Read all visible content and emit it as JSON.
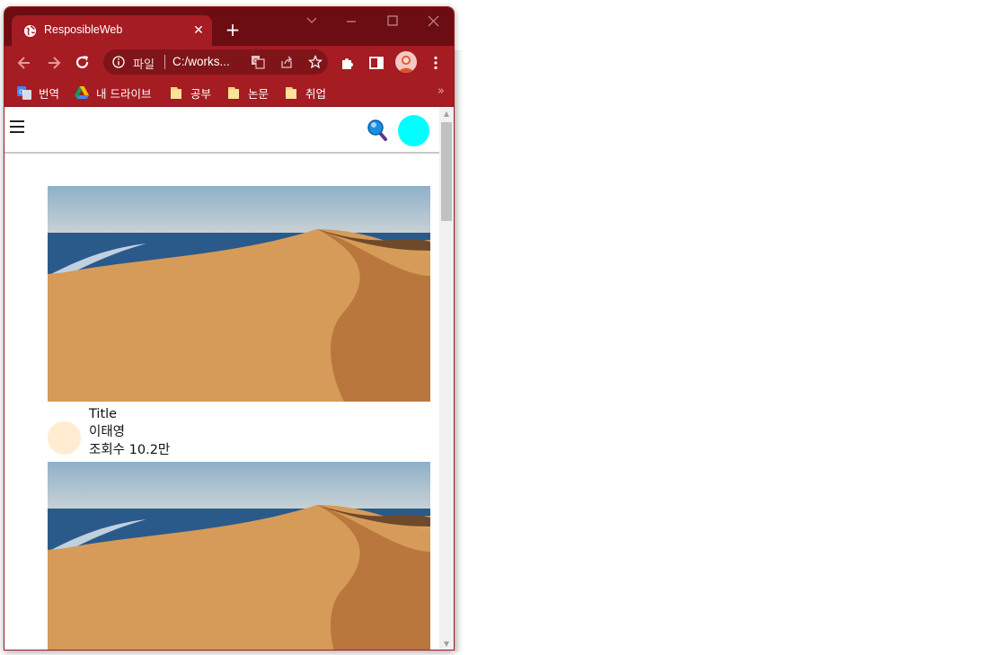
{
  "browser": {
    "tab_title": "ResposibleWeb",
    "omnibox": {
      "scheme_label": "파일",
      "url": "C:/works..."
    },
    "bookmarks": [
      {
        "label": "번역",
        "icon": "translate-icon"
      },
      {
        "label": "내 드라이브",
        "icon": "google-drive-icon"
      },
      {
        "label": "공부",
        "icon": "folder-icon"
      },
      {
        "label": "논문",
        "icon": "folder-icon"
      },
      {
        "label": "취업",
        "icon": "folder-icon"
      }
    ],
    "bookmarks_more": "»",
    "theme_color": "#a51c22",
    "frame_color": "#6b0d13"
  },
  "page": {
    "header": {
      "menu_icon": "hamburger-menu-icon",
      "search_icon": "search-icon",
      "avatar_color": "#00ffff"
    },
    "videos": [
      {
        "title": "Title",
        "author": "이태영",
        "views": "조회수 10.2만",
        "thumbnail": "desert-dune-ocean-image",
        "avatar_color": "#ffecd1"
      },
      {
        "thumbnail": "desert-dune-ocean-image"
      }
    ]
  }
}
